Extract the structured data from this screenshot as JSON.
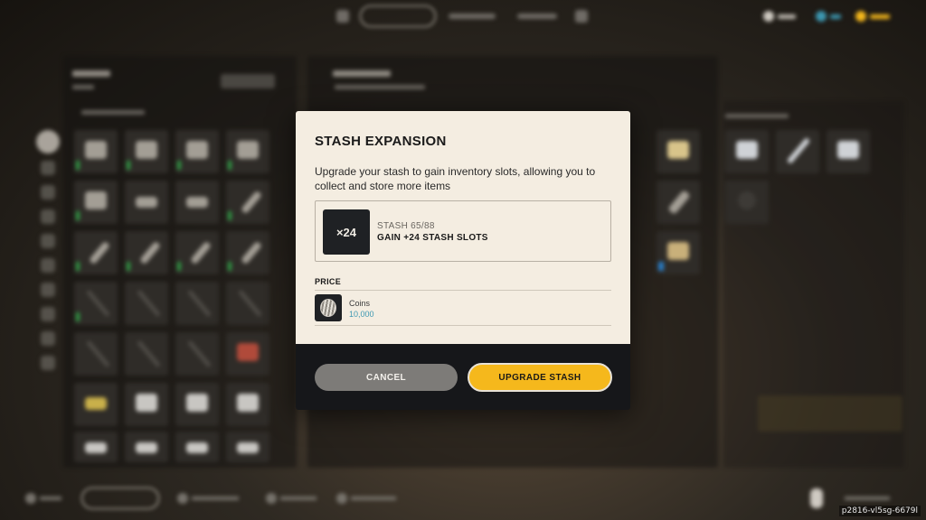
{
  "modal": {
    "title": "STASH EXPANSION",
    "description": "Upgrade your stash to gain inventory slots, allowing you to collect and store more items",
    "item": {
      "thumb_label": "×24",
      "stash_status": "STASH 65/88",
      "gain_text": "GAIN +24 STASH SLOTS"
    },
    "price": {
      "label": "PRICE",
      "currency_name": "Coins",
      "amount": "10,000",
      "currency_icon": "coin-icon"
    },
    "cancel_label": "CANCEL",
    "upgrade_label": "UPGRADE STASH",
    "colors": {
      "body_bg": "#f4ede1",
      "footer_bg": "#16171a",
      "upgrade_button": "#f5b81c",
      "cancel_button": "#7d7b78",
      "amount_text": "#3d98b2"
    }
  },
  "watermark": "p2816-vl5sg-6679l"
}
